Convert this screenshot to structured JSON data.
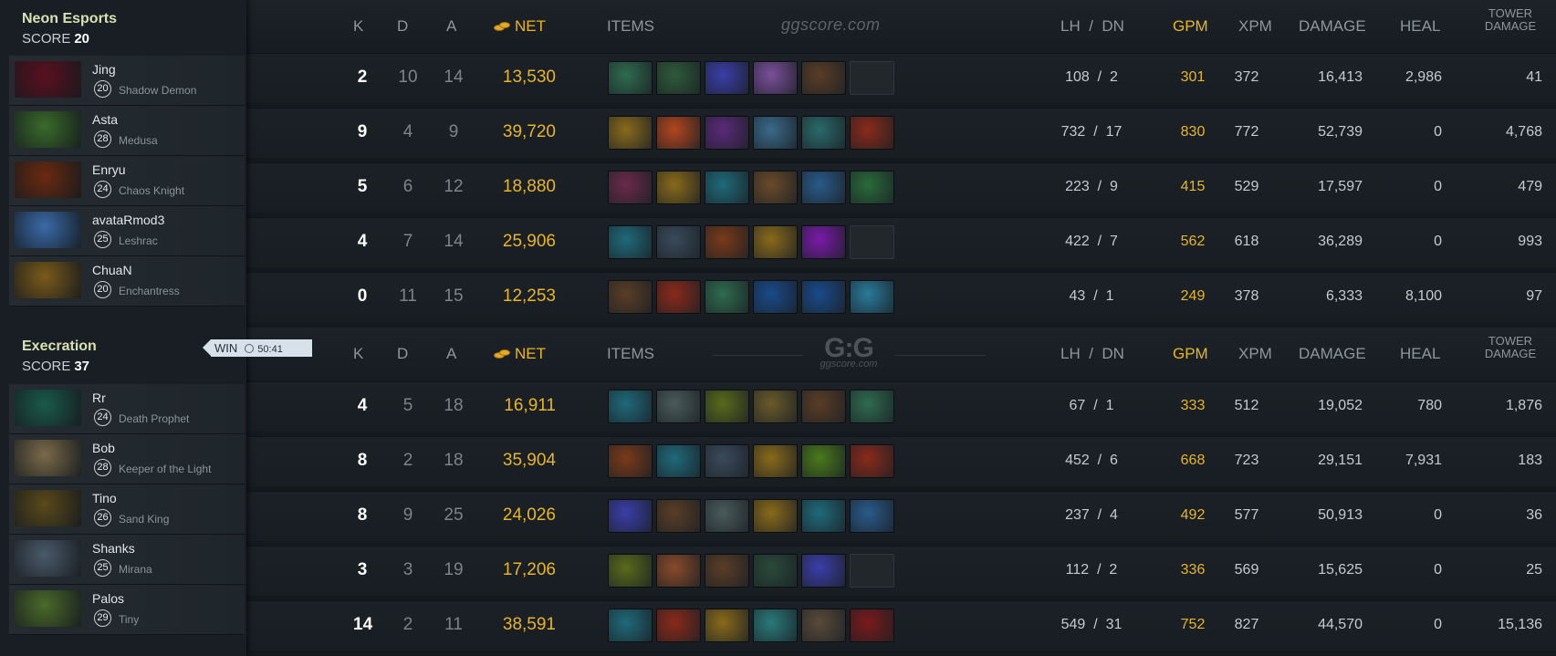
{
  "colors": {
    "gold": "#e8b52b",
    "panel": "#181e23",
    "row": "#1b2126",
    "win_tag": "#d7e1ea"
  },
  "teams": [
    {
      "name": "Neon Esports",
      "score_label": "SCORE",
      "score": "20",
      "players": [
        {
          "name": "Jing",
          "level": "20",
          "hero": "Shadow Demon",
          "k": "2",
          "d": "10",
          "a": "14",
          "net": "13,530",
          "lh": "108",
          "dn": "2",
          "gpm": "301",
          "xpm": "372",
          "damage": "16,413",
          "heal": "2,986",
          "tower": "41",
          "items": [
            {
              "icon": "axe-item-icon",
              "color": "#2f6b4f"
            },
            {
              "icon": "staff-item-icon",
              "color": "#2f5a3a"
            },
            {
              "icon": "blue-blade-item-icon",
              "color": "#3b3ea8"
            },
            {
              "icon": "gold-orb-item-icon",
              "color": "#7a4f9a"
            },
            {
              "icon": "boots-item-icon",
              "color": "#5a3d26"
            },
            {
              "icon": "empty-slot",
              "color": ""
            }
          ]
        },
        {
          "name": "Asta",
          "level": "28",
          "hero": "Medusa",
          "k": "9",
          "d": "4",
          "a": "9",
          "net": "39,720",
          "lh": "732",
          "dn": "17",
          "gpm": "830",
          "xpm": "772",
          "damage": "52,739",
          "heal": "0",
          "tower": "4,768",
          "items": [
            {
              "icon": "gold-helm-item-icon",
              "color": "#8a6a1a"
            },
            {
              "icon": "crossed-blades-item-icon",
              "color": "#b3461e"
            },
            {
              "icon": "purple-claw-item-icon",
              "color": "#5a2a7a"
            },
            {
              "icon": "moon-item-icon",
              "color": "#3a6a8a"
            },
            {
              "icon": "orb-item-icon",
              "color": "#2a6a6a"
            },
            {
              "icon": "dragon-item-icon",
              "color": "#8a2a1a"
            }
          ]
        },
        {
          "name": "Enryu",
          "level": "24",
          "hero": "Chaos Knight",
          "k": "5",
          "d": "6",
          "a": "12",
          "net": "18,880",
          "lh": "223",
          "dn": "9",
          "gpm": "415",
          "xpm": "529",
          "damage": "17,597",
          "heal": "0",
          "tower": "479",
          "items": [
            {
              "icon": "pink-rune-item-icon",
              "color": "#6a2a4a"
            },
            {
              "icon": "gold-helm-item-icon",
              "color": "#8a6a1a"
            },
            {
              "icon": "blue-axe-item-icon",
              "color": "#1f6a7a"
            },
            {
              "icon": "boots-item-icon",
              "color": "#6a4a2a"
            },
            {
              "icon": "globe-item-icon",
              "color": "#2a5a8a"
            },
            {
              "icon": "green-swirl-item-icon",
              "color": "#2a6a3a"
            }
          ]
        },
        {
          "name": "avataRmod3",
          "level": "25",
          "hero": "Leshrac",
          "k": "4",
          "d": "7",
          "a": "14",
          "net": "25,906",
          "lh": "422",
          "dn": "7",
          "gpm": "562",
          "xpm": "618",
          "damage": "36,289",
          "heal": "0",
          "tower": "993",
          "items": [
            {
              "icon": "blue-axe-item-icon",
              "color": "#1f6a7a"
            },
            {
              "icon": "mask-item-icon",
              "color": "#3a4a5a"
            },
            {
              "icon": "cloak-item-icon",
              "color": "#7a3a1a"
            },
            {
              "icon": "gold-helm-item-icon",
              "color": "#8a6a1a"
            },
            {
              "icon": "purple-sword-item-icon",
              "color": "#7a1aa8"
            },
            {
              "icon": "empty-slot",
              "color": ""
            }
          ]
        },
        {
          "name": "ChuaN",
          "level": "20",
          "hero": "Enchantress",
          "k": "0",
          "d": "11",
          "a": "15",
          "net": "12,253",
          "lh": "43",
          "dn": "1",
          "gpm": "249",
          "xpm": "378",
          "damage": "6,333",
          "heal": "8,100",
          "tower": "97",
          "items": [
            {
              "icon": "boots-item-icon",
              "color": "#5a3d26"
            },
            {
              "icon": "red-shield-item-icon",
              "color": "#8a2a1a"
            },
            {
              "icon": "axe-item-icon",
              "color": "#2f6b4f"
            },
            {
              "icon": "mango-item-icon",
              "color": "#1a4a8a"
            },
            {
              "icon": "mango-item-icon",
              "color": "#1a4a8a"
            },
            {
              "icon": "blue-egg-item-icon",
              "color": "#2a7a9a"
            }
          ]
        }
      ]
    },
    {
      "name": "Execration",
      "score_label": "SCORE",
      "score": "37",
      "players": [
        {
          "name": "Rr",
          "level": "24",
          "hero": "Death Prophet",
          "k": "4",
          "d": "5",
          "a": "18",
          "net": "16,911",
          "lh": "67",
          "dn": "1",
          "gpm": "333",
          "xpm": "512",
          "damage": "19,052",
          "heal": "780",
          "tower": "1,876",
          "items": [
            {
              "icon": "blue-axe-item-icon",
              "color": "#1f6a7a"
            },
            {
              "icon": "white-blade-item-icon",
              "color": "#4a5a5a"
            },
            {
              "icon": "trident-item-icon",
              "color": "#5a6a1a"
            },
            {
              "icon": "gold-mech-item-icon",
              "color": "#6a5a2a"
            },
            {
              "icon": "boots-item-icon",
              "color": "#5a3d26"
            },
            {
              "icon": "axe-item-icon",
              "color": "#2f6b4f"
            }
          ]
        },
        {
          "name": "Bob",
          "level": "28",
          "hero": "Keeper of the Light",
          "k": "8",
          "d": "2",
          "a": "18",
          "net": "35,904",
          "lh": "452",
          "dn": "6",
          "gpm": "668",
          "xpm": "723",
          "damage": "29,151",
          "heal": "7,931",
          "tower": "183",
          "items": [
            {
              "icon": "cloak-item-icon",
              "color": "#7a3a1a"
            },
            {
              "icon": "blue-axe-item-icon",
              "color": "#1f6a7a"
            },
            {
              "icon": "mask-item-icon",
              "color": "#3a4a5a"
            },
            {
              "icon": "gold-helm-item-icon",
              "color": "#8a6a1a"
            },
            {
              "icon": "green-sword-item-icon",
              "color": "#4a7a1a"
            },
            {
              "icon": "red-claw-item-icon",
              "color": "#8a2a1a"
            }
          ]
        },
        {
          "name": "Tino",
          "level": "26",
          "hero": "Sand King",
          "k": "8",
          "d": "9",
          "a": "25",
          "net": "24,026",
          "lh": "237",
          "dn": "4",
          "gpm": "492",
          "xpm": "577",
          "damage": "50,913",
          "heal": "0",
          "tower": "36",
          "items": [
            {
              "icon": "blue-blade-item-icon",
              "color": "#3b3ea8"
            },
            {
              "icon": "boots-item-icon",
              "color": "#5a3d26"
            },
            {
              "icon": "white-blade-item-icon",
              "color": "#4a5a5a"
            },
            {
              "icon": "gold-helm-item-icon",
              "color": "#8a6a1a"
            },
            {
              "icon": "blue-axe-item-icon",
              "color": "#1f6a7a"
            },
            {
              "icon": "globe-item-icon",
              "color": "#2a5a8a"
            }
          ]
        },
        {
          "name": "Shanks",
          "level": "25",
          "hero": "Mirana",
          "k": "3",
          "d": "3",
          "a": "19",
          "net": "17,206",
          "lh": "112",
          "dn": "2",
          "gpm": "336",
          "xpm": "569",
          "damage": "15,625",
          "heal": "0",
          "tower": "25",
          "items": [
            {
              "icon": "trident-item-icon",
              "color": "#5a6a1a"
            },
            {
              "icon": "round-shield-item-icon",
              "color": "#8a4a2a"
            },
            {
              "icon": "boots-item-icon",
              "color": "#5a3d26"
            },
            {
              "icon": "green-gem-item-icon",
              "color": "#2a4a3a"
            },
            {
              "icon": "blue-blade-item-icon",
              "color": "#3b3ea8"
            },
            {
              "icon": "empty-slot",
              "color": ""
            }
          ]
        },
        {
          "name": "Palos",
          "level": "29",
          "hero": "Tiny",
          "k": "14",
          "d": "2",
          "a": "11",
          "net": "38,591",
          "lh": "549",
          "dn": "31",
          "gpm": "752",
          "xpm": "827",
          "damage": "44,570",
          "heal": "0",
          "tower": "15,136",
          "items": [
            {
              "icon": "blue-axe-item-icon",
              "color": "#1f6a7a"
            },
            {
              "icon": "dragon-item-icon",
              "color": "#8a2a1a"
            },
            {
              "icon": "gold-helm-item-icon",
              "color": "#8a6a1a"
            },
            {
              "icon": "armor-item-icon",
              "color": "#2a7a7a"
            },
            {
              "icon": "white-blade-item-icon",
              "color": "#5a4a3a"
            },
            {
              "icon": "red-scythe-item-icon",
              "color": "#7a1a1a"
            }
          ]
        }
      ]
    }
  ],
  "result": {
    "label": "WIN",
    "duration": "50:41"
  },
  "columns": {
    "k": "K",
    "d": "D",
    "a": "A",
    "net": "NET",
    "items": "ITEMS",
    "lh": "LH",
    "sep": "/",
    "dn": "DN",
    "gpm": "GPM",
    "xpm": "XPM",
    "damage": "DAMAGE",
    "heal": "HEAL",
    "tower_1": "TOWER",
    "tower_2": "DAMAGE"
  },
  "watermarks": {
    "top": "ggscore.com",
    "logo": "G:G",
    "logo_sub": "ggscore.com"
  }
}
